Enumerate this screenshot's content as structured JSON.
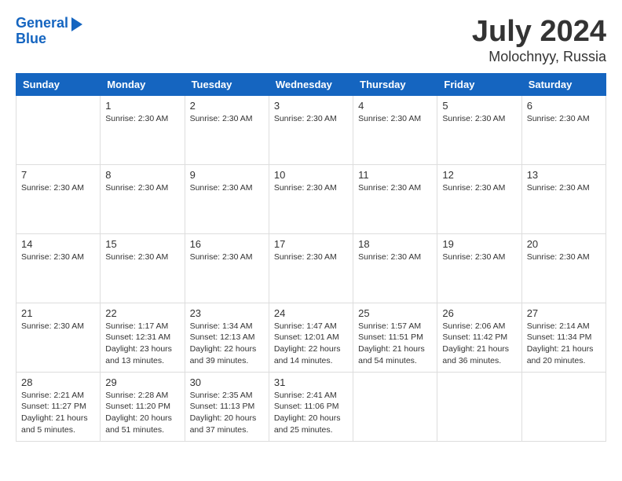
{
  "header": {
    "logo_line1": "General",
    "logo_line2": "Blue",
    "month": "July 2024",
    "location": "Molochnyy, Russia"
  },
  "weekdays": [
    "Sunday",
    "Monday",
    "Tuesday",
    "Wednesday",
    "Thursday",
    "Friday",
    "Saturday"
  ],
  "weeks": [
    [
      {
        "day": "",
        "info": ""
      },
      {
        "day": "1",
        "info": "Sunrise: 2:30 AM"
      },
      {
        "day": "2",
        "info": "Sunrise: 2:30 AM"
      },
      {
        "day": "3",
        "info": "Sunrise: 2:30 AM"
      },
      {
        "day": "4",
        "info": "Sunrise: 2:30 AM"
      },
      {
        "day": "5",
        "info": "Sunrise: 2:30 AM"
      },
      {
        "day": "6",
        "info": "Sunrise: 2:30 AM"
      }
    ],
    [
      {
        "day": "7",
        "info": "Sunrise: 2:30 AM"
      },
      {
        "day": "8",
        "info": "Sunrise: 2:30 AM"
      },
      {
        "day": "9",
        "info": "Sunrise: 2:30 AM"
      },
      {
        "day": "10",
        "info": "Sunrise: 2:30 AM"
      },
      {
        "day": "11",
        "info": "Sunrise: 2:30 AM"
      },
      {
        "day": "12",
        "info": "Sunrise: 2:30 AM"
      },
      {
        "day": "13",
        "info": "Sunrise: 2:30 AM"
      }
    ],
    [
      {
        "day": "14",
        "info": "Sunrise: 2:30 AM"
      },
      {
        "day": "15",
        "info": "Sunrise: 2:30 AM"
      },
      {
        "day": "16",
        "info": "Sunrise: 2:30 AM"
      },
      {
        "day": "17",
        "info": "Sunrise: 2:30 AM"
      },
      {
        "day": "18",
        "info": "Sunrise: 2:30 AM"
      },
      {
        "day": "19",
        "info": "Sunrise: 2:30 AM"
      },
      {
        "day": "20",
        "info": "Sunrise: 2:30 AM"
      }
    ],
    [
      {
        "day": "21",
        "info": "Sunrise: 2:30 AM"
      },
      {
        "day": "22",
        "info": "Sunrise: 1:17 AM\nSunset: 12:31 AM\nDaylight: 23 hours and 13 minutes."
      },
      {
        "day": "23",
        "info": "Sunrise: 1:34 AM\nSunset: 12:13 AM\nDaylight: 22 hours and 39 minutes."
      },
      {
        "day": "24",
        "info": "Sunrise: 1:47 AM\nSunset: 12:01 AM\nDaylight: 22 hours and 14 minutes."
      },
      {
        "day": "25",
        "info": "Sunrise: 1:57 AM\nSunset: 11:51 PM\nDaylight: 21 hours and 54 minutes."
      },
      {
        "day": "26",
        "info": "Sunrise: 2:06 AM\nSunset: 11:42 PM\nDaylight: 21 hours and 36 minutes."
      },
      {
        "day": "27",
        "info": "Sunrise: 2:14 AM\nSunset: 11:34 PM\nDaylight: 21 hours and 20 minutes."
      }
    ],
    [
      {
        "day": "28",
        "info": "Sunrise: 2:21 AM\nSunset: 11:27 PM\nDaylight: 21 hours and 5 minutes."
      },
      {
        "day": "29",
        "info": "Sunrise: 2:28 AM\nSunset: 11:20 PM\nDaylight: 20 hours and 51 minutes."
      },
      {
        "day": "30",
        "info": "Sunrise: 2:35 AM\nSunset: 11:13 PM\nDaylight: 20 hours and 37 minutes."
      },
      {
        "day": "31",
        "info": "Sunrise: 2:41 AM\nSunset: 11:06 PM\nDaylight: 20 hours and 25 minutes."
      },
      {
        "day": "",
        "info": ""
      },
      {
        "day": "",
        "info": ""
      },
      {
        "day": "",
        "info": ""
      }
    ]
  ]
}
